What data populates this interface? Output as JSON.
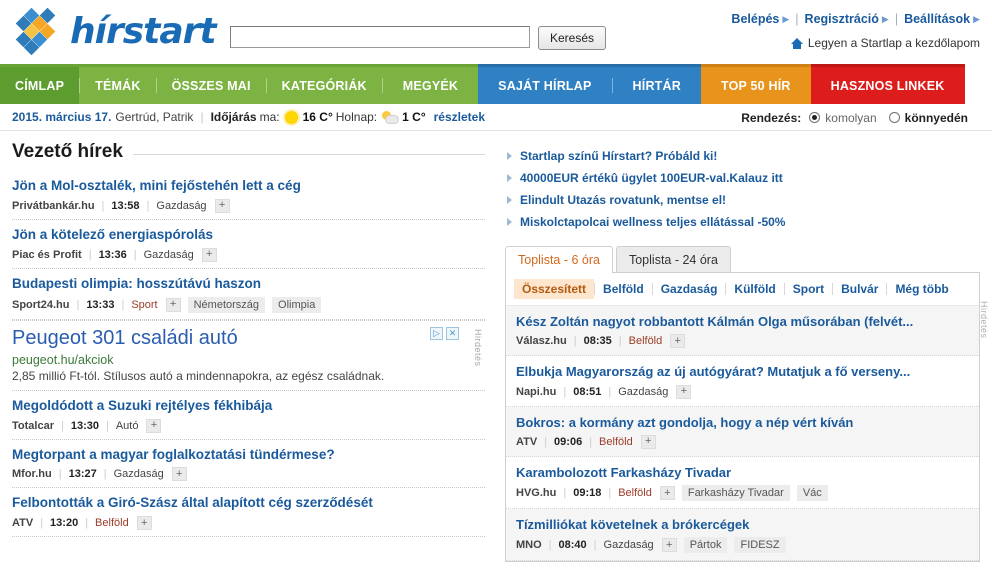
{
  "header": {
    "logo_text": "hírstart",
    "search": {
      "value": "",
      "placeholder": "",
      "button_label": "Keresés"
    },
    "top_links": [
      {
        "label": "Belépés"
      },
      {
        "label": "Regisztráció"
      },
      {
        "label": "Beállítások"
      }
    ],
    "startlap_label": "Legyen a Startlap a kezdőlapom"
  },
  "nav": {
    "green_items": [
      {
        "label": "CÍMLAP",
        "active": true
      },
      {
        "label": "TÉMÁK",
        "active": false
      },
      {
        "label": "ÖSSZES MAI",
        "active": false
      },
      {
        "label": "KATEGÓRIÁK",
        "active": false
      },
      {
        "label": "MEGYÉK",
        "active": false
      }
    ],
    "blue_items": [
      {
        "label": "SAJÁT HÍRLAP"
      },
      {
        "label": "HÍRTÁR"
      }
    ],
    "orange_item": {
      "label": "TOP 50 HÍR"
    },
    "red_item": {
      "label": "HASZNOS LINKEK"
    }
  },
  "datebar": {
    "date": "2015. március 17.",
    "namedays": "Gertrúd, Patrik",
    "weather_label": "Időjárás",
    "today_label": "ma:",
    "today_temp": "16 C°",
    "tomorrow_label": "Holnap:",
    "tomorrow_temp": "1 C°",
    "details_label": "részletek",
    "sort_label": "Rendezés:",
    "sort_options": [
      {
        "label": "komolyan",
        "selected": true
      },
      {
        "label": "könnyedén",
        "selected": false
      }
    ]
  },
  "left": {
    "section_title": "Vezető hírek",
    "ad_label": "Hirdetés",
    "items_before_ad": [
      {
        "title": "Jön a Mol-osztalék, mini fejőstehén lett a cég",
        "source": "Privátbankár.hu",
        "time": "13:58",
        "category": "Gazdaság",
        "plus": "+",
        "tags": []
      },
      {
        "title": "Jön a kötelező energiaspórolás",
        "source": "Piac és Profit",
        "time": "13:36",
        "category": "Gazdaság",
        "plus": "+",
        "tags": []
      },
      {
        "title": "Budapesti olimpia: hosszútávú haszon",
        "source": "Sport24.hu",
        "time": "13:33",
        "category": "Sport",
        "plus": "+",
        "tags": [
          "Németország",
          "Olimpia"
        ]
      }
    ],
    "ad": {
      "title": "Peugeot 301 családi autó",
      "url": "peugeot.hu/akciok",
      "desc": "2,85 millió Ft-tól. Stílusos autó a mindennapokra, az egész családnak.",
      "adchoices_icon": "▷",
      "close_icon": "✕"
    },
    "items_after_ad": [
      {
        "title": "Megoldódott a Suzuki rejtélyes fékhibája",
        "source": "Totalcar",
        "time": "13:30",
        "category": "Autó",
        "plus": "+",
        "tags": []
      },
      {
        "title": "Megtorpant a magyar foglalkoztatási tündérmese?",
        "source": "Mfor.hu",
        "time": "13:27",
        "category": "Gazdaság",
        "plus": "+",
        "tags": []
      },
      {
        "title": "Felbontották a Giró-Szász által alapított cég szerződését",
        "source": "ATV",
        "time": "13:20",
        "category": "Belföld",
        "plus": "+",
        "tags": []
      }
    ]
  },
  "right": {
    "ad_label": "Hirdetés",
    "promos": [
      {
        "label": "Startlap színű Hírstart? Próbáld ki!"
      },
      {
        "label": "40000EUR értékû ügylet 100EUR-val.Kalauz itt"
      },
      {
        "label": "Elindult Utazás rovatunk, mentse el!"
      },
      {
        "label": "Miskolctapolcai wellness teljes ellátással -50%"
      }
    ],
    "tabs": [
      {
        "label": "Toplista - 6 óra",
        "active": true
      },
      {
        "label": "Toplista - 24 óra",
        "active": false
      }
    ],
    "subtabs": [
      {
        "label": "Összesített",
        "active": true
      },
      {
        "label": "Belföld",
        "active": false
      },
      {
        "label": "Gazdaság",
        "active": false
      },
      {
        "label": "Külföld",
        "active": false
      },
      {
        "label": "Sport",
        "active": false
      },
      {
        "label": "Bulvár",
        "active": false
      },
      {
        "label": "Még több",
        "active": false
      }
    ],
    "items": [
      {
        "title": "Kész Zoltán nagyot robbantott Kálmán Olga műsorában (felvét...",
        "source": "Válasz.hu",
        "time": "08:35",
        "category": "Belföld",
        "plus": "+",
        "tags": []
      },
      {
        "title": "Elbukja Magyarország az új autógyárat? Mutatjuk a fő verseny...",
        "source": "Napi.hu",
        "time": "08:51",
        "category": "Gazdaság",
        "plus": "+",
        "tags": []
      },
      {
        "title": "Bokros: a kormány azt gondolja, hogy a nép vért kíván",
        "source": "ATV",
        "time": "09:06",
        "category": "Belföld",
        "plus": "+",
        "tags": []
      },
      {
        "title": "Karambolozott Farkasházy Tivadar",
        "source": "HVG.hu",
        "time": "09:18",
        "category": "Belföld",
        "plus": "+",
        "tags": [
          "Farkasházy Tivadar",
          "Vác"
        ]
      },
      {
        "title": "Tízmilliókat követelnek a brókercégek",
        "source": "MNO",
        "time": "08:40",
        "category": "Gazdaság",
        "plus": "+",
        "tags": [
          "Pártok",
          "FIDESZ"
        ]
      }
    ]
  },
  "colors": {
    "link_blue": "#1a5a9c",
    "nav_green": "#7cb342",
    "nav_green_active": "#5d9c2e",
    "nav_blue": "#3080c4",
    "nav_orange": "#e8931c",
    "nav_red": "#dd1c1c",
    "tab_active_text": "#d2691e"
  }
}
